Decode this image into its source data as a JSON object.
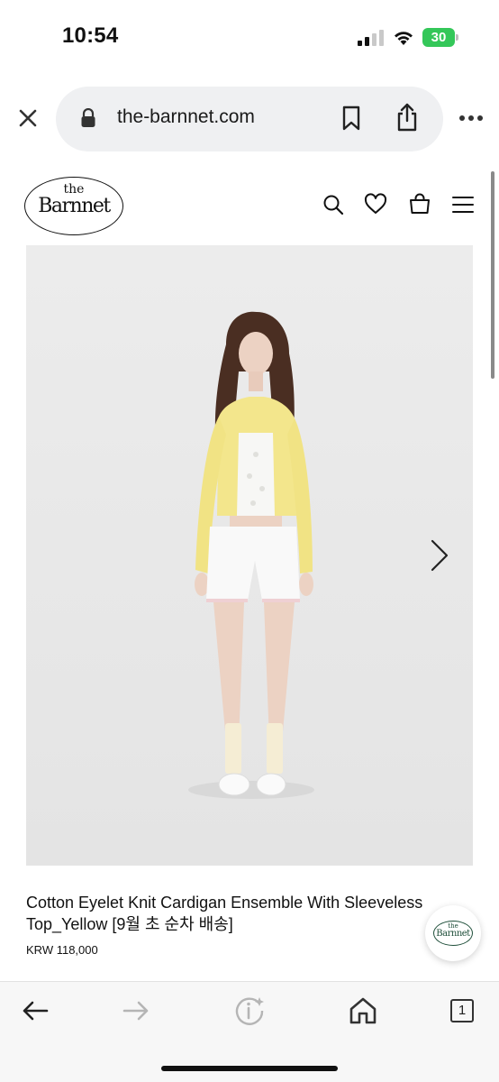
{
  "status_bar": {
    "time": "10:54",
    "battery_level": "30"
  },
  "address_bar": {
    "url": "the-barnnet.com",
    "icons": [
      "close-icon",
      "lock-icon",
      "bookmark-icon",
      "share-icon",
      "more-icon"
    ]
  },
  "site_header": {
    "logo_the": "the",
    "logo_name": "Barnnet",
    "icons": [
      "search-icon",
      "heart-icon",
      "shopping-bag-icon",
      "menu-icon"
    ]
  },
  "product": {
    "title": "Cotton Eyelet Knit Cardigan Ensemble With Sleeveless Top_Yellow [9월 초 순차 배송]",
    "price": "KRW 118,000",
    "image_description_icon": "product-photo",
    "colors": {
      "cardigan": "#f3e68c",
      "background": "#ebebeb"
    }
  },
  "floating_badge": {
    "the": "the",
    "name": "Barnnet",
    "color": "#1f4f3a"
  },
  "toolbar": {
    "tab_count": "1",
    "icons": [
      "back-arrow-icon",
      "forward-arrow-icon",
      "page-info-icon",
      "home-icon",
      "tabs-icon"
    ]
  }
}
